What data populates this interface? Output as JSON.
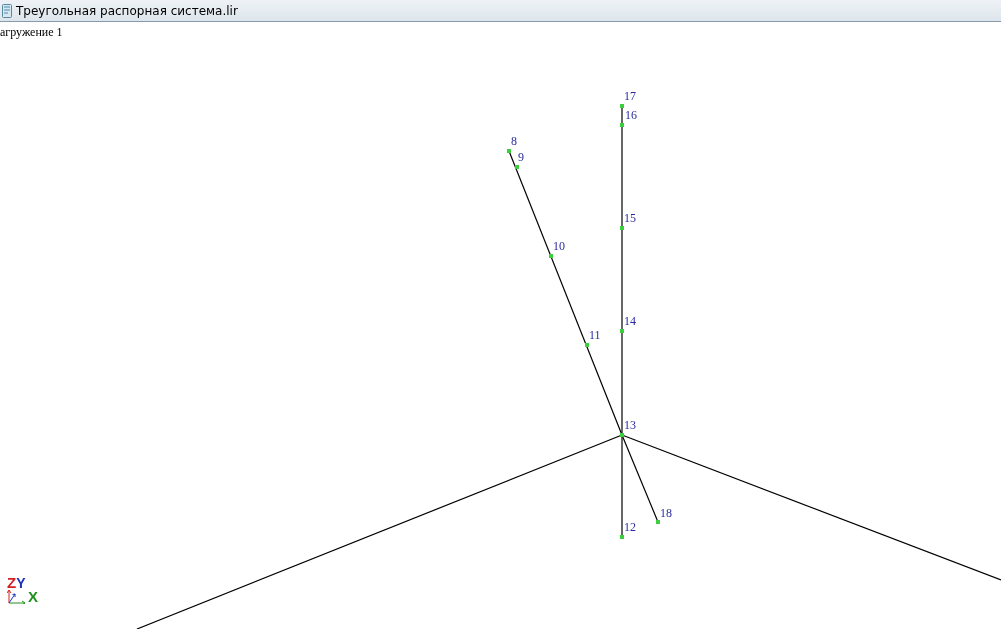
{
  "window": {
    "title": "Треугольная распорная система.lir"
  },
  "load_case": "агружение 1",
  "nodes": [
    {
      "label": "17"
    },
    {
      "label": "16"
    },
    {
      "label": "8"
    },
    {
      "label": "9"
    },
    {
      "label": "15"
    },
    {
      "label": "10"
    },
    {
      "label": "14"
    },
    {
      "label": "11"
    },
    {
      "label": "13"
    },
    {
      "label": "18"
    },
    {
      "label": "12"
    }
  ],
  "axes": [
    {
      "label": "Z",
      "color": "#d42020"
    },
    {
      "label": "Y",
      "color": "#2030c0"
    },
    {
      "label": "X",
      "color": "#209020"
    }
  ]
}
